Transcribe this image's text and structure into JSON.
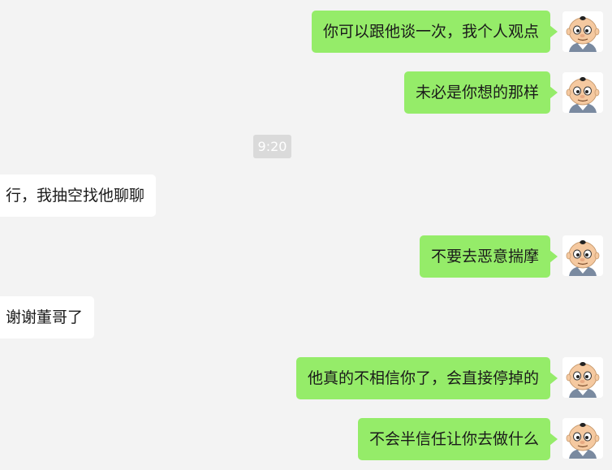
{
  "messages": [
    {
      "side": "out",
      "text": "你可以跟他谈一次，我个人观点",
      "avatar": "cartoon-boy-icon"
    },
    {
      "side": "out",
      "text": "未必是你想的那样",
      "avatar": "cartoon-boy-icon"
    },
    {
      "side": "time",
      "text": "9:20"
    },
    {
      "side": "in",
      "text": "行，我抽空找他聊聊"
    },
    {
      "side": "out",
      "text": "不要去恶意揣摩",
      "avatar": "cartoon-boy-icon"
    },
    {
      "side": "in",
      "text": "谢谢董哥了"
    },
    {
      "side": "out",
      "text": "他真的不相信你了，会直接停掉的",
      "avatar": "cartoon-boy-icon"
    },
    {
      "side": "out",
      "text": "不会半信任让你去做什么",
      "avatar": "cartoon-boy-icon"
    }
  ],
  "colors": {
    "background": "#f3f3f3",
    "outgoing_bubble": "#95ec69",
    "incoming_bubble": "#ffffff",
    "timestamp_bg": "#dadada"
  }
}
